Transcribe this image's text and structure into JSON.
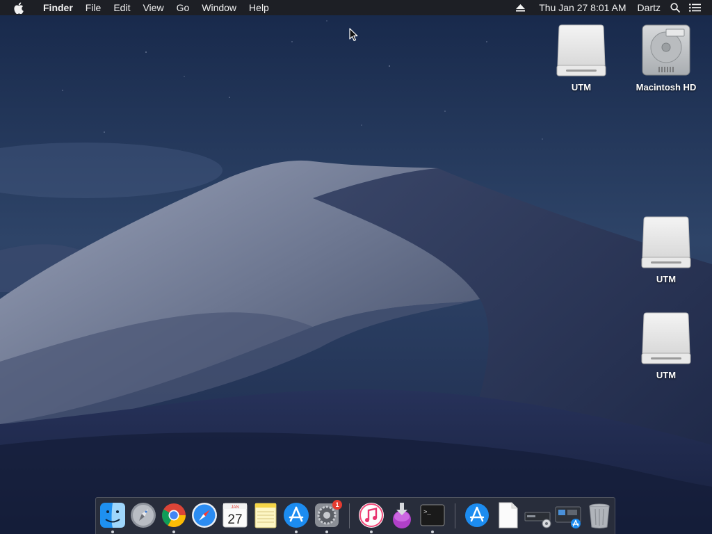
{
  "menubar": {
    "app_name": "Finder",
    "menus": [
      "File",
      "Edit",
      "View",
      "Go",
      "Window",
      "Help"
    ],
    "status": {
      "clock": "Thu Jan 27  8:01 AM",
      "user": "Dartz",
      "icons": [
        "eject-icon",
        "spotlight-search-icon",
        "notification-center-icon"
      ]
    }
  },
  "desktop": {
    "icons": [
      {
        "label": "UTM",
        "kind": "external-drive-icon"
      },
      {
        "label": "Macintosh HD",
        "kind": "hard-drive-icon"
      },
      {
        "label": "UTM",
        "kind": "external-drive-icon"
      },
      {
        "label": "UTM",
        "kind": "external-drive-icon"
      }
    ]
  },
  "dock": {
    "apps": [
      {
        "name": "finder-icon",
        "running": true
      },
      {
        "name": "launchpad-icon",
        "running": false
      },
      {
        "name": "chrome-icon",
        "running": true
      },
      {
        "name": "safari-icon",
        "running": false
      },
      {
        "name": "calendar-icon",
        "running": false,
        "month": "JAN",
        "day": "27"
      },
      {
        "name": "notes-icon",
        "running": false
      },
      {
        "name": "app-store-icon",
        "running": true
      },
      {
        "name": "system-preferences-icon",
        "running": true,
        "badge": "1"
      },
      {
        "name": "itunes-icon",
        "running": true
      },
      {
        "name": "installer-icon",
        "running": false
      },
      {
        "name": "terminal-icon",
        "running": true,
        "prompt": ">_"
      },
      {
        "name": "app-store-folder-icon",
        "running": false
      },
      {
        "name": "document-icon",
        "running": false
      },
      {
        "name": "disk-utility-icon",
        "running": false
      },
      {
        "name": "installer-stack-icon",
        "running": false
      },
      {
        "name": "trash-icon",
        "running": false
      }
    ]
  },
  "colors": {
    "menubar_bg": "#1e1e22",
    "sky_top": "#1b2b4c",
    "sky_bottom": "#3a4f75",
    "dune_light": "#8890a8",
    "dune_dark": "#1f2947",
    "badge": "#e53b30"
  }
}
